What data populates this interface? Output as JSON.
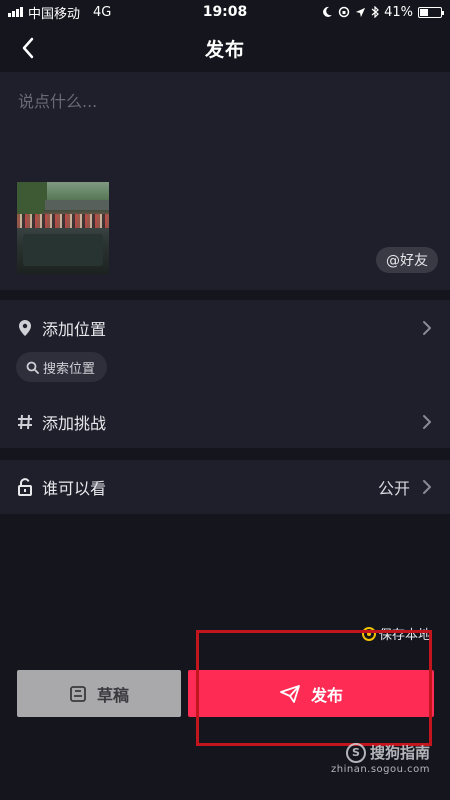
{
  "status_bar": {
    "carrier": "中国移动",
    "network": "4G",
    "time": "19:08",
    "battery_percent": "41%",
    "battery_level": 0.41
  },
  "header": {
    "title": "发布",
    "back_icon": "chevron-left-icon"
  },
  "caption": {
    "placeholder": "说点什么...",
    "mention_button": "@好友"
  },
  "options": {
    "location_label": "添加位置",
    "search_location": "搜索位置",
    "challenge_label": "添加挑战",
    "privacy_label": "谁可以看",
    "privacy_value": "公开"
  },
  "save_local": "保存本地",
  "actions": {
    "draft": "草稿",
    "publish": "发布"
  },
  "watermark": {
    "brand": "搜狗指南",
    "url": "zhinan.sogou.com"
  },
  "colors": {
    "background": "#15151e",
    "panel": "#1f1f2b",
    "publish": "#fe2c55",
    "draft": "#a9a9ac",
    "annotation_box": "#c2151d",
    "check": "#f2c200"
  }
}
